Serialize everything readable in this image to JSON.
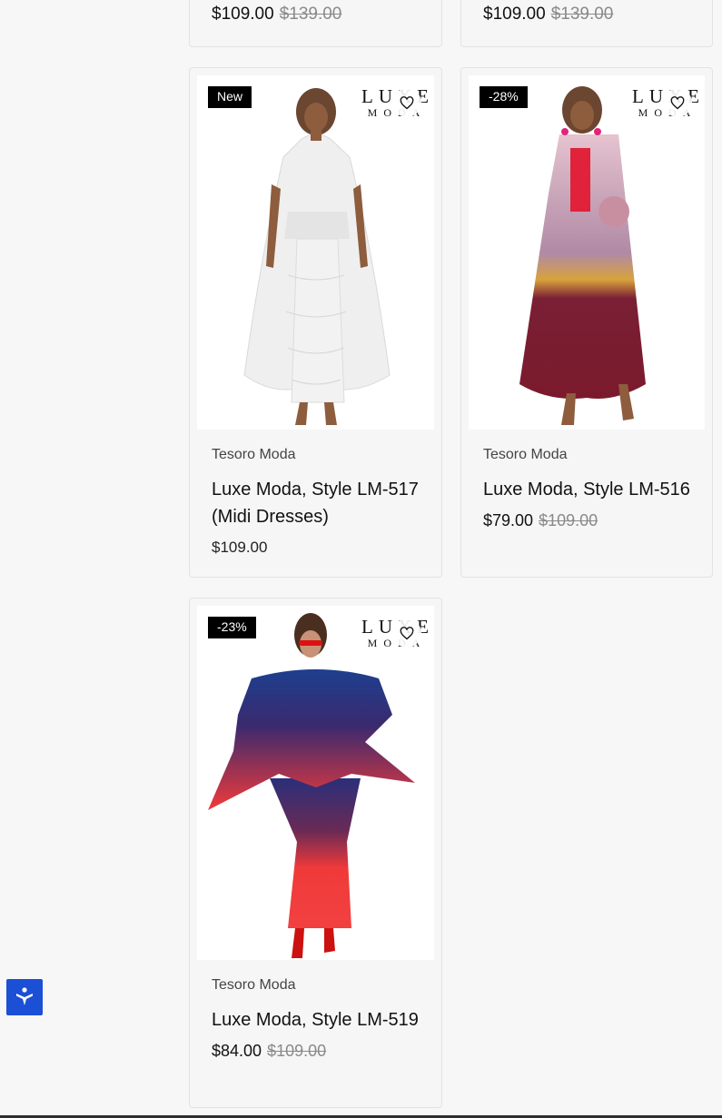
{
  "top_cards": [
    {
      "price_now": "$109.00",
      "price_was": "$139.00"
    },
    {
      "price_now": "$109.00",
      "price_was": "$139.00"
    }
  ],
  "products": [
    {
      "badge": "New",
      "logo_line1": "LUXE",
      "logo_line2": "MODA",
      "vendor": "Tesoro Moda",
      "title": "Luxe Moda, Style LM-517 (Midi Dresses)",
      "price": "$109.00"
    },
    {
      "badge": "-28%",
      "logo_line1": "LUXE",
      "logo_line2": "MODA",
      "vendor": "Tesoro Moda",
      "title": "Luxe Moda, Style LM-516",
      "price_now": "$79.00",
      "price_was": "$109.00"
    },
    {
      "badge": "-23%",
      "logo_line1": "LUXE",
      "logo_line2": "MODA",
      "vendor": "Tesoro Moda",
      "title": "Luxe Moda, Style LM-519",
      "price_now": "$84.00",
      "price_was": "$109.00"
    }
  ],
  "icons": {
    "wishlist": "heart-outline-icon",
    "accessibility": "accessibility-person-icon"
  },
  "colors": {
    "badge_bg": "#000000",
    "accessibility_bg": "#1a4fd6",
    "strike_price": "#8a8a8a"
  }
}
